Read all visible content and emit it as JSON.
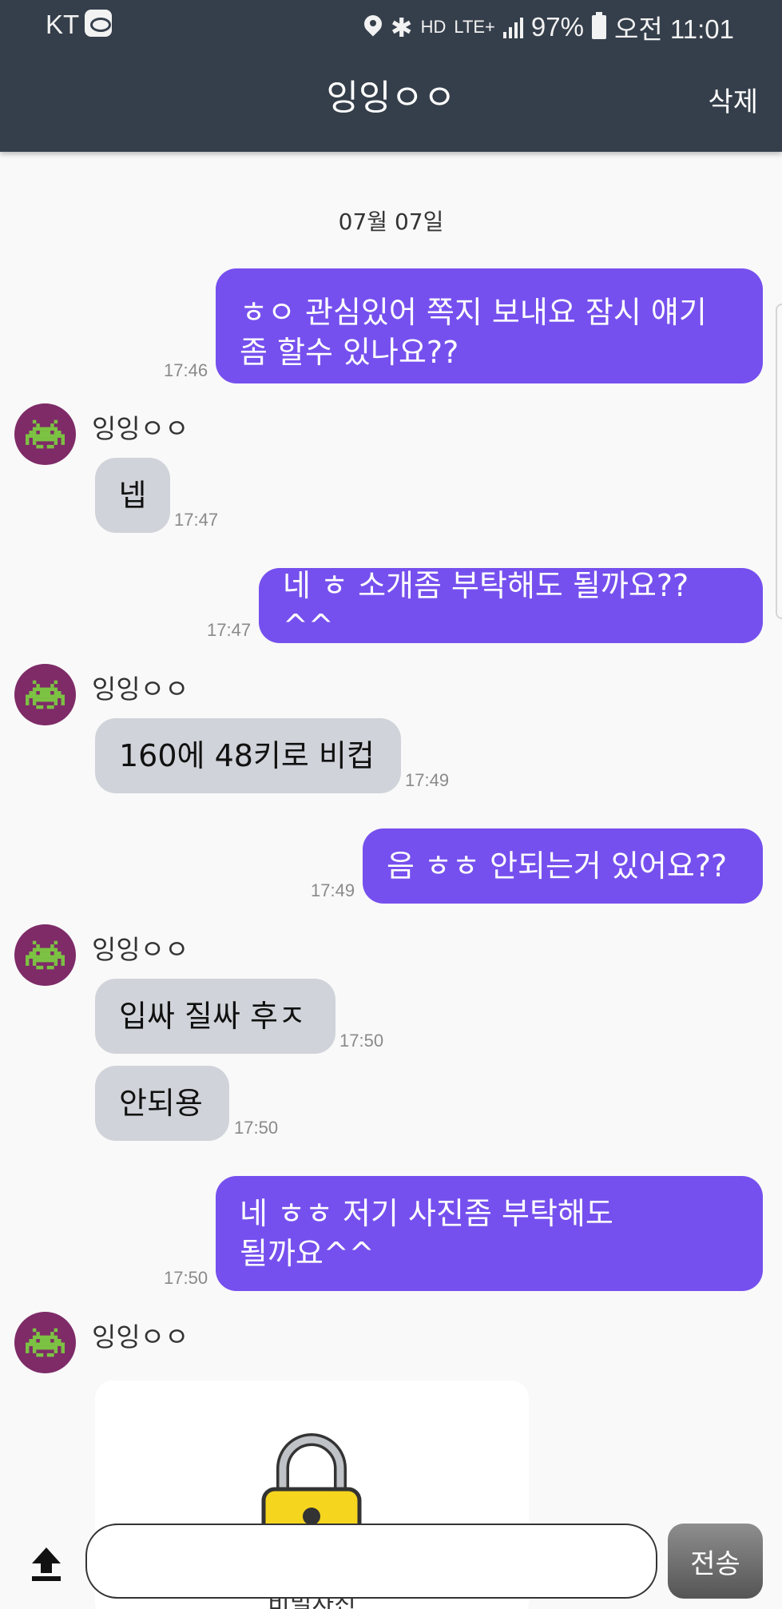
{
  "status_bar": {
    "carrier": "KT",
    "battery": "97%",
    "time": "오전 11:01",
    "hd": "HD",
    "network": "LTE+"
  },
  "header": {
    "title": "잉잉ㅇㅇ",
    "delete_label": "삭제"
  },
  "date_label": "07월 07일",
  "messages": [
    {
      "side": "sent",
      "lines": [
        "ㅎㅇ 관심있어 쪽지 보내요 잠시 얘기",
        "좀 할수 있나요??"
      ],
      "time": "17:46"
    },
    {
      "side": "received",
      "sender": "잉잉ㅇㅇ",
      "text": "넵",
      "time": "17:47"
    },
    {
      "side": "sent",
      "text": "네 ㅎ 소개좀 부탁해도 될까요?? ^^",
      "time": "17:47"
    },
    {
      "side": "received",
      "sender": "잉잉ㅇㅇ",
      "text": "160에 48키로 비컵",
      "time": "17:49"
    },
    {
      "side": "sent",
      "text": "음 ㅎㅎ 안되는거 있어요??",
      "time": "17:49"
    },
    {
      "side": "received",
      "sender": "잉잉ㅇㅇ",
      "text": "입싸 질싸 후ㅈ",
      "time": "17:50"
    },
    {
      "side": "received",
      "text": "안되용",
      "time": "17:50"
    },
    {
      "side": "sent",
      "lines": [
        "네 ㅎㅎ 저기 사진좀 부탁해도",
        "될까요^^"
      ],
      "time": "17:50"
    },
    {
      "side": "received",
      "sender": "잉잉ㅇㅇ",
      "image": "lock-icon",
      "caption": "비밀사진"
    }
  ],
  "composer": {
    "placeholder": "",
    "send_label": "전송",
    "upload_icon": "upload-icon"
  },
  "colors": {
    "header": "#353f4b",
    "sent_bubble": "#7650ee",
    "received_bubble": "#d0d3d9",
    "avatar": "#7e2b68",
    "avatar_icon": "#7cc243"
  }
}
